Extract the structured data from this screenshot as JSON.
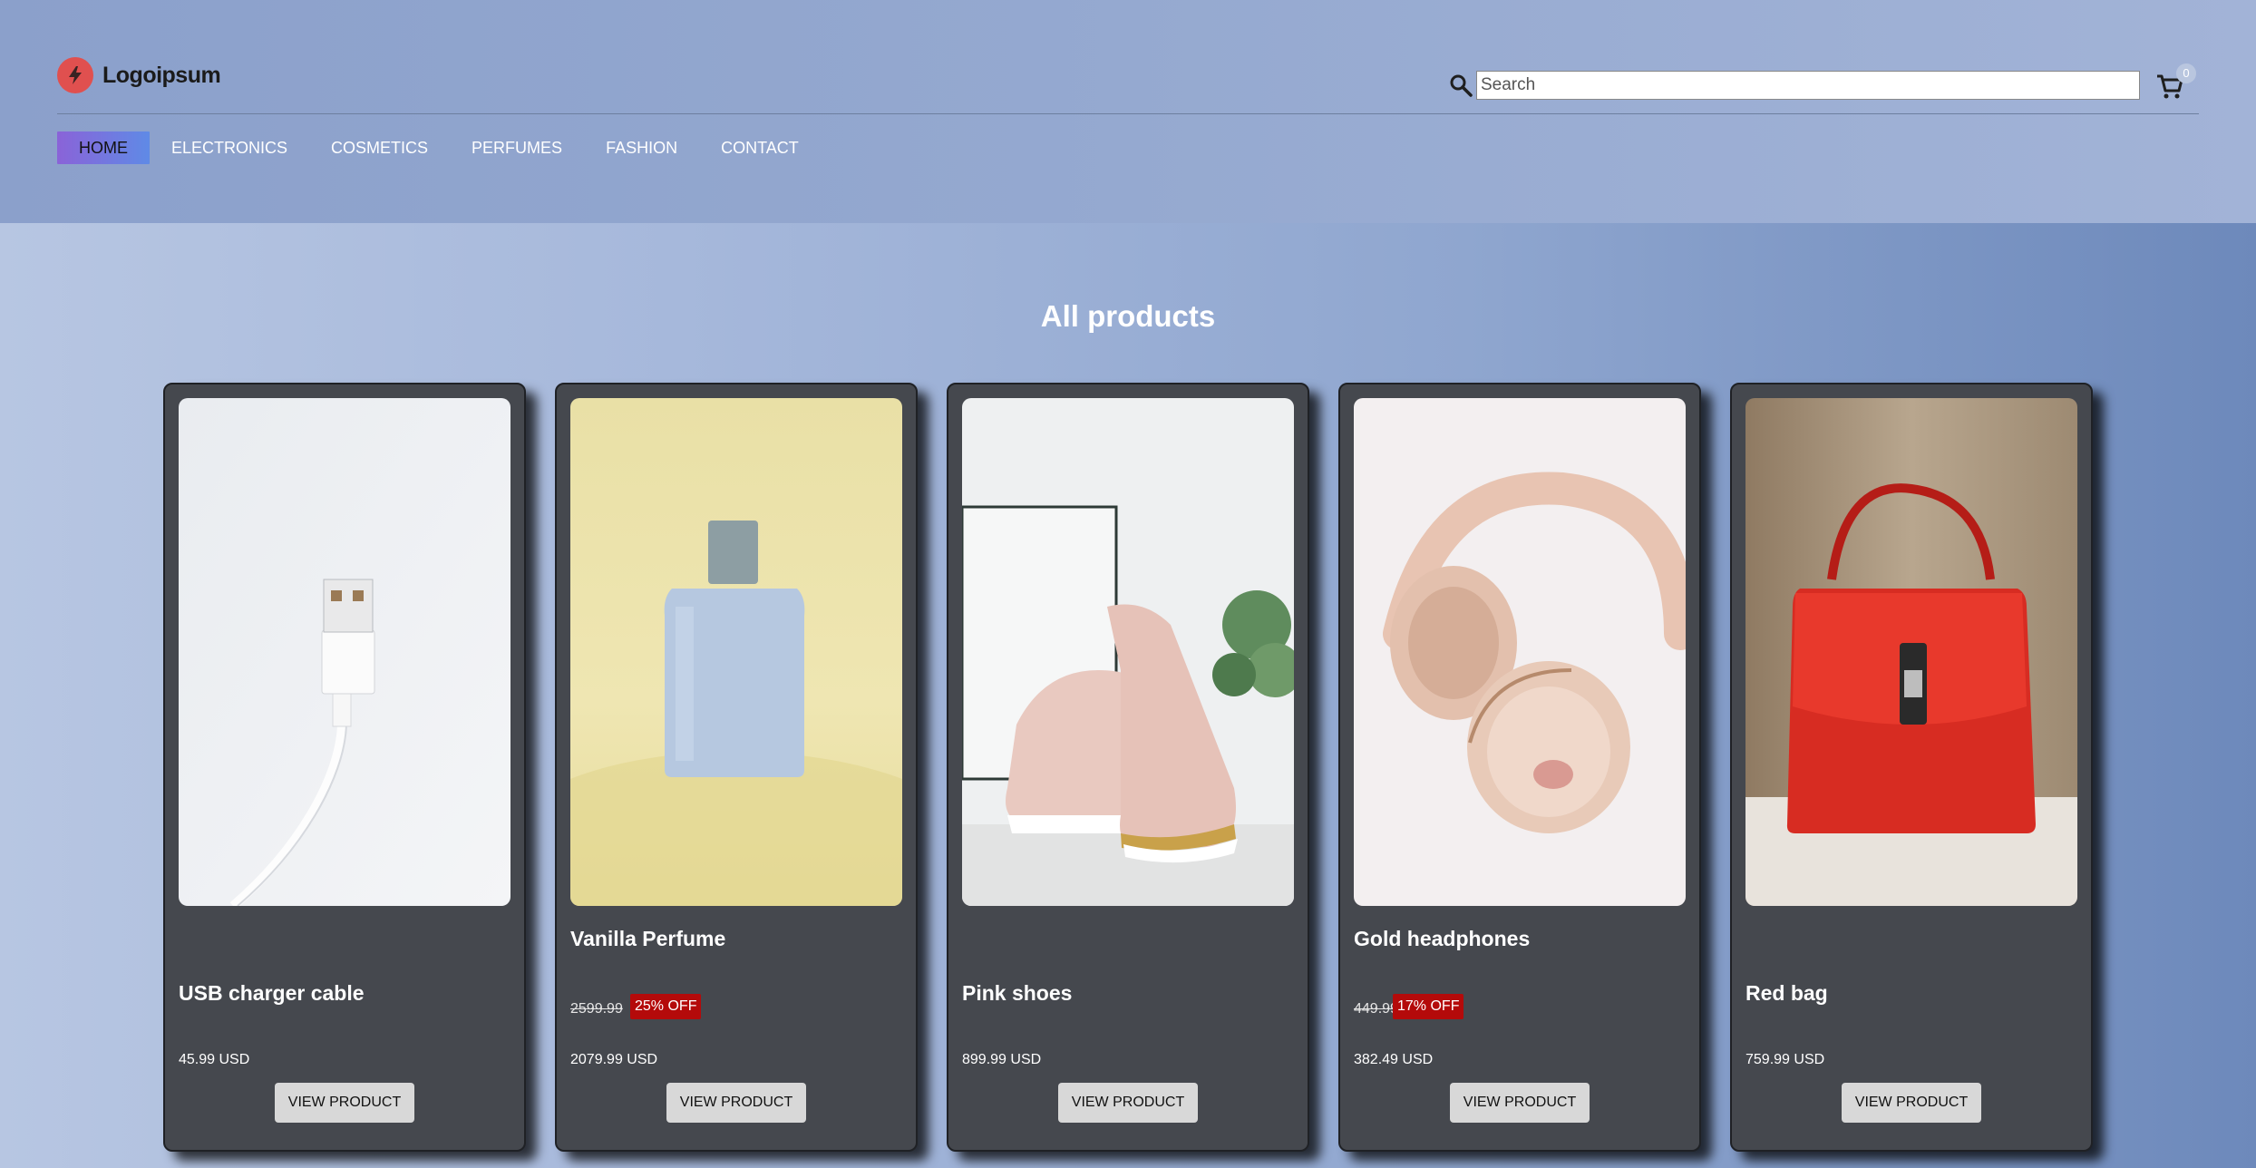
{
  "header": {
    "logo_text": "Logoipsum",
    "search_placeholder": "Search",
    "cart_count": "0",
    "nav": [
      "HOME",
      "ELECTRONICS",
      "COSMETICS",
      "PERFUMES",
      "FASHION",
      "CONTACT"
    ],
    "active_nav": "HOME"
  },
  "main": {
    "title": "All products",
    "products": [
      {
        "name": "USB charger cable",
        "price": "45.99 USD",
        "button": "VIEW PRODUCT"
      },
      {
        "name": "Vanilla Perfume",
        "old_price": "2599.99",
        "discount": "25% OFF",
        "price": "2079.99 USD",
        "button": "VIEW PRODUCT"
      },
      {
        "name": "Pink shoes",
        "price": "899.99 USD",
        "button": "VIEW PRODUCT"
      },
      {
        "name": "Gold headphones",
        "old_price": "449.99",
        "discount": "17% OFF",
        "price": "382.49 USD",
        "button": "VIEW PRODUCT"
      },
      {
        "name": "Red bag",
        "price": "759.99 USD",
        "button": "VIEW PRODUCT"
      }
    ]
  },
  "icons": {
    "logo": "lightning-logo-icon",
    "search": "search-icon",
    "cart": "cart-icon"
  },
  "colors": {
    "logo_red": "#e0504f",
    "discount_bg": "#b40a0a",
    "card_bg": "#45484e",
    "nav_active_start": "#8a63d8",
    "nav_active_end": "#5f8ae6"
  }
}
